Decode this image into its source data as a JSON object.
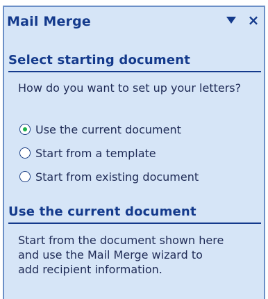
{
  "pane": {
    "title": "Mail Merge",
    "dropdown_icon": "triangle-down-icon",
    "close_label": "×"
  },
  "step": {
    "heading": "Select starting document",
    "question": "How do you want to set up your letters?",
    "options": [
      {
        "label": "Use the current document",
        "selected": true
      },
      {
        "label": "Start from a template",
        "selected": false
      },
      {
        "label": "Start from existing document",
        "selected": false
      }
    ]
  },
  "detail": {
    "heading": "Use the current document",
    "text": "Start from the document shown here and use the Mail Merge wizard to add recipient information."
  },
  "colors": {
    "pane_bg": "#d6e5f7",
    "heading": "#143a8c",
    "radio_dot": "#1bb14b"
  }
}
